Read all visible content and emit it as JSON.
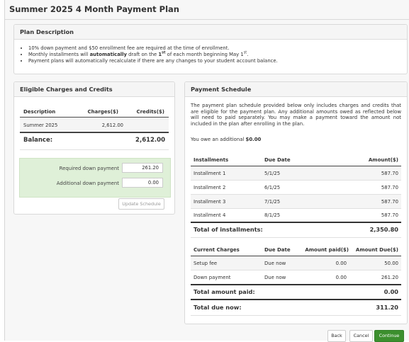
{
  "title": "Summer 2025 4 Month Payment Plan",
  "plan_description": {
    "heading": "Plan Description",
    "bullet1": "10% down payment and $50 enrollment fee are required at the time of enrollment.",
    "bullet2_pre": "Monthly installments will ",
    "bullet2_bold": "automatically",
    "bullet2_mid": " draft on the ",
    "bullet2_day": "1",
    "bullet2_sup": "st",
    "bullet2_mid2": " of each month beginning May 1",
    "bullet2_sup2": "st",
    "bullet2_end": ".",
    "bullet3": "Payment plans will automatically recalculate if there are any changes to your student account balance."
  },
  "eligible": {
    "heading": "Eligible Charges and Credits",
    "col_description": "Description",
    "col_charges": "Charges($)",
    "col_credits": "Credits($)",
    "row_term": "Summer 2025",
    "row_charges": "2,612.00",
    "row_credits": "",
    "balance_label": "Balance:",
    "balance_value": "2,612.00",
    "required_label": "Required down payment",
    "required_value": "261.20",
    "additional_label": "Additional down payment",
    "additional_value": "0.00",
    "update_button": "Update Schedule"
  },
  "schedule": {
    "heading": "Payment Schedule",
    "text": "The payment plan schedule provided below only includes charges and credits that are eligible for the payment plan. Any additional amounts owed as reflected below will need to paid separately. You may make a payment toward the amount not included in the plan after enrolling in the plan.",
    "owe_text": "You owe an additional ",
    "owe_amount": "$0.00",
    "col_installments": "Installments",
    "col_due_date": "Due Date",
    "col_amount": "Amount($)",
    "installments": [
      {
        "name": "Installment 1",
        "date": "5/1/25",
        "amount": "587.70"
      },
      {
        "name": "Installment 2",
        "date": "6/1/25",
        "amount": "587.70"
      },
      {
        "name": "Installment 3",
        "date": "7/1/25",
        "amount": "587.70"
      },
      {
        "name": "Installment 4",
        "date": "8/1/25",
        "amount": "587.70"
      }
    ],
    "total_installments_label": "Total of installments:",
    "total_installments_value": "2,350.80",
    "col_current_charges": "Current Charges",
    "col_due_date2": "Due Date",
    "col_amount_paid": "Amount paid($)",
    "col_amount_due": "Amount Due($)",
    "charges": [
      {
        "name": "Setup fee",
        "date": "Due now",
        "paid": "0.00",
        "due": "50.00"
      },
      {
        "name": "Down payment",
        "date": "Due now",
        "paid": "0.00",
        "due": "261.20"
      }
    ],
    "total_paid_label": "Total amount paid:",
    "total_paid_value": "0.00",
    "total_due_label": "Total due now:",
    "total_due_value": "311.20"
  },
  "buttons": {
    "back": "Back",
    "cancel": "Cancel",
    "continue": "Continue"
  }
}
